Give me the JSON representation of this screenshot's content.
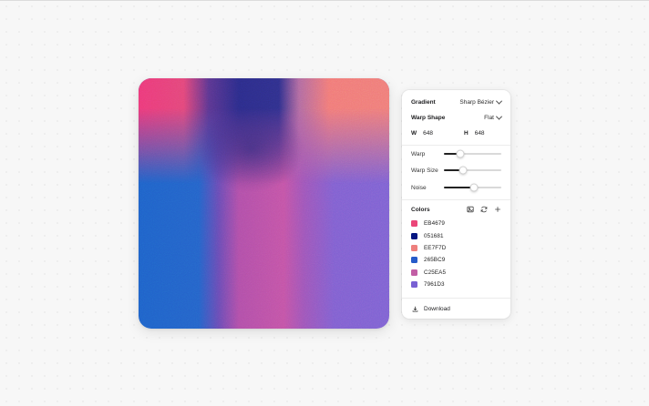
{
  "canvas": {
    "colors_used": [
      "#EB4679",
      "#051681",
      "#EE7F7D",
      "#265BC9",
      "#C25EA5",
      "#7961D3"
    ]
  },
  "panel": {
    "gradient": {
      "label": "Gradient",
      "value": "Sharp Bézier"
    },
    "warp_shape": {
      "label": "Warp Shape",
      "value": "Flat"
    },
    "size": {
      "w_label": "W",
      "w_value": "648",
      "h_label": "H",
      "h_value": "648"
    },
    "sliders": [
      {
        "label": "Warp",
        "value_fraction": 0.28
      },
      {
        "label": "Warp Size",
        "value_fraction": 0.34
      },
      {
        "label": "Noise",
        "value_fraction": 0.52
      }
    ],
    "colors": {
      "label": "Colors",
      "tools": [
        "image-icon",
        "refresh-icon",
        "plus-icon"
      ],
      "items": [
        {
          "hex": "EB4679",
          "swatch": "#EB4679"
        },
        {
          "hex": "051681",
          "swatch": "#051681"
        },
        {
          "hex": "EE7F7D",
          "swatch": "#EE7F7D"
        },
        {
          "hex": "265BC9",
          "swatch": "#265BC9"
        },
        {
          "hex": "C25EA5",
          "swatch": "#C25EA5"
        },
        {
          "hex": "7961D3",
          "swatch": "#7961D3"
        }
      ]
    },
    "download_label": "Download"
  }
}
